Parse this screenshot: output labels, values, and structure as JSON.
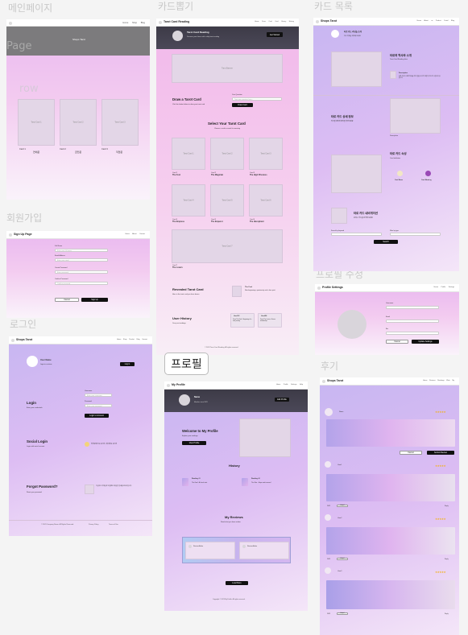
{
  "labels": {
    "main": "메인페이지",
    "draw": "카드뽑기",
    "cardlist": "카드 목록",
    "signup": "회원가입",
    "login": "로그인",
    "profile": "프로필",
    "profile_edit": "프로필 수정",
    "review": "후기",
    "page": "Page",
    "row": "row"
  },
  "main_page": {
    "title": "Shops Tarot",
    "tiles": [
      {
        "ph": "Tarot Card 1",
        "no": "Card 1",
        "name": "연애운"
      },
      {
        "ph": "Tarot Card 2",
        "no": "Card 2",
        "name": "금전운"
      },
      {
        "ph": "Tarot Card 3",
        "no": "Card 3",
        "name": "직업운"
      }
    ]
  },
  "draw_page": {
    "nav_title": "Tarot Card Reading",
    "nav_menu": "Home  Draw Card  Card Library  History",
    "hero_title": "Tarot Card Reading",
    "hero_sub": "Discover your future with a daily tarot reading",
    "hero_btn": "Get Started",
    "banner": "Tarot Banner",
    "draw_title": "Draw a Tarot Card",
    "draw_sub": "Click the button below to draw your tarot card",
    "q_label": "Your Question",
    "q_placeholder": "Type your question here...",
    "draw_btn": "Draw Card",
    "select_title": "Select Your Tarot Card",
    "select_sub": "Choose a card to reveal its meaning",
    "cards": [
      {
        "ph": "Tarot Card 1",
        "no": "Card 1",
        "name": "The Fool"
      },
      {
        "ph": "Tarot Card 2",
        "no": "Card 2",
        "name": "The Magician"
      },
      {
        "ph": "Tarot Card 3",
        "no": "Card 3",
        "name": "The High Priestess"
      },
      {
        "ph": "Tarot Card 4",
        "no": "Card 4",
        "name": "The Empress"
      },
      {
        "ph": "Tarot Card 5",
        "no": "Card 5",
        "name": "The Emperor"
      },
      {
        "ph": "Tarot Card 6",
        "no": "Card 6",
        "name": "The Hierophant"
      }
    ],
    "wide_ph": "Tarot Card 7",
    "wide_no": "Card 7",
    "wide_name": "The Lovers",
    "revealed_title": "Revealed Tarot Card",
    "revealed_sub": "Here is the tarot card you have drawn",
    "revealed_card": "The Fool",
    "revealed_desc": "New beginnings, spontaneity and a free spirit",
    "history_title": "User History",
    "history_sub": "Your past readings",
    "hist1_name": "User123",
    "hist1_text": "Drew The Fool - Beginning of a new journey",
    "hist2_name": "User456",
    "hist2_text": "Drew The Lovers - A new relationship",
    "footer": "© 2023 Tarot Card Reading. All rights reserved."
  },
  "cardlist_page": {
    "nav_title": "Shops Tarot",
    "nav_menu": "Home  About us  Product Detail  Blog",
    "top_title": "타로 카드 리딩을 소개",
    "top_sub": "카드 목록을 확인해 보세요",
    "intro_title": "타로의 역사와 소개",
    "intro_sub": "Tarot Card Reading Intro",
    "intro_item": "Description",
    "intro_desc": "타로 카드는 오랜 역사를 가진 점술 도구로 78장의 카드로 구성되어 있습니다",
    "detail_title": "타로 카드 상세 정보",
    "detail_sub": "카드별 의미와 해석을 확인하세요",
    "attr_title": "타로 카드 속성",
    "attr_sub": "Card attributes",
    "attr_a": "Card Name",
    "attr_b": "Card Meaning",
    "nav2_title": "타로 카드 네비게이션",
    "nav2_sub": "원하는 카드를 검색해 보세요",
    "f1_label": "Search by keyword",
    "f2_label": "Filter by type",
    "search_btn": "Search"
  },
  "signup_page": {
    "nav_title": "Sign Up Page",
    "nav_menu": "Home  About  Contact",
    "fields": [
      {
        "label": "Full Name",
        "ph": "Enter your full name"
      },
      {
        "label": "Email Address",
        "ph": "Enter your email"
      },
      {
        "label": "Create Password",
        "ph": "Enter password"
      },
      {
        "label": "Confirm Password",
        "ph": "Confirm password"
      }
    ],
    "cancel": "Cancel",
    "submit": "Sign Up"
  },
  "login_page": {
    "nav_title": "Shops Tarot",
    "nav_menu": "Home  Shop  Product  Blog  Contact",
    "user_name": "User Name",
    "user_sub": "Login to continue",
    "user_btn": "Log in",
    "login_title": "Login",
    "login_sub": "Enter your credentials",
    "id_label": "Username",
    "id_ph": "Enter your username",
    "pw_label": "Password",
    "pw_ph": "Enter your password",
    "login_btn": "Login to Account",
    "social_title": "Social Login",
    "social_sub": "Login with social account",
    "social_text": "카카오톡으로 로그인 / 네이버로 로그인",
    "forgot_title": "Forgot Password?",
    "forgot_sub": "Reset your password",
    "forgot_text": "가입하신 이메일로 비밀번호 재설정 링크를 보내드립니다",
    "footer_l": "© 2023 Company Name. All Rights Reserved.",
    "footer_m": "Privacy Policy",
    "footer_r": "Terms of Use"
  },
  "profile_page": {
    "tag": "프로필",
    "nav_title": "My Profile",
    "nav_menu": "Home  Profile  Settings  Help",
    "user_name": "Name",
    "user_sub": "Member since 2023",
    "edit_btn": "Edit Profile",
    "welcome_title": "Welcome to My Profile",
    "welcome_sub": "Explore your readings",
    "welcome_btn": "View Profile",
    "history_title": "History",
    "h1_title": "Reading #1",
    "h1_text": "The Fool - A fresh start",
    "h2_title": "Reading #2",
    "h2_text": "The Star - Hope and renewal",
    "reviews_title": "My Reviews",
    "reviews_sub": "Read what you have written",
    "r1": "Review Author",
    "r2": "Review Author",
    "more_btn": "Load More",
    "footer": "Copyright © 2023 My Profile. All rights reserved."
  },
  "profile_edit_page": {
    "nav_title": "Profile Settings",
    "nav_menu": "Home  Profile  Settings",
    "f1": "Username",
    "f2": "Email",
    "f3": "Bio",
    "cancel": "Cancel",
    "save": "Update Settings"
  },
  "review_page": {
    "nav_title": "Shops Tarot",
    "nav_menu": "Home  Reviews  Readings  Write  My",
    "first_name": "Name",
    "stars": "★★★★★",
    "first_cancel": "Cancel",
    "first_submit": "Submit Review",
    "names": [
      "User1",
      "User2",
      "User3",
      "User4"
    ],
    "date": "2023",
    "like_btn": "Helpful",
    "reply": "Reply"
  },
  "colors": {
    "accent": "#111111",
    "dark_header": "#3d3b47",
    "star": "#f2b21c"
  }
}
